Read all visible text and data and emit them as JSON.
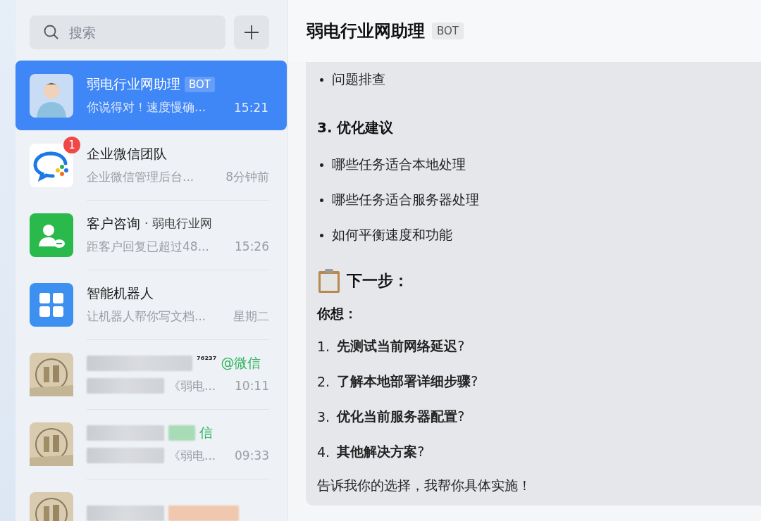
{
  "search": {
    "placeholder": "搜索"
  },
  "chats": [
    {
      "kind": "person",
      "name": "弱电行业网助理",
      "tag": "BOT",
      "preview": "你说得对！速度慢确...",
      "time": "15:21",
      "selected": true
    },
    {
      "kind": "wecom",
      "name": "企业微信团队",
      "badge": "1",
      "preview": "企业微信管理后台...",
      "time": "8分钟前",
      "selected": false
    },
    {
      "kind": "contact",
      "name": "客户咨询",
      "source": "· 弱电行业网",
      "preview": "距客户回复已超过48...",
      "time": "15:26",
      "selected": false
    },
    {
      "kind": "apps",
      "name": "智能机器人",
      "preview": "让机器人帮你写文档...",
      "time": "星期二",
      "selected": false
    },
    {
      "kind": "picture",
      "blurred": true,
      "name": "⁷⁶²³⁷",
      "suffix": "@微信",
      "preview": "《弱电...",
      "time": "10:11",
      "selected": false
    },
    {
      "kind": "picture",
      "blurred": true,
      "suffix": "信",
      "preview": "《弱电...",
      "time": "09:33",
      "selected": false
    },
    {
      "kind": "picture",
      "blurred": true,
      "selected": false
    }
  ],
  "conversation": {
    "title": "弱电行业网助理",
    "tag": "BOT",
    "message": [
      {
        "kind": "bullet",
        "text": "问题排查"
      },
      {
        "kind": "heading",
        "text": "3. 优化建议"
      },
      {
        "kind": "bullet",
        "text": "哪些任务适合本地处理"
      },
      {
        "kind": "bullet",
        "text": "哪些任务适合服务器处理"
      },
      {
        "kind": "bullet",
        "text": "如何平衡速度和功能"
      },
      {
        "kind": "clipboard-heading",
        "text": "下一步："
      },
      {
        "kind": "bold",
        "text": "你想："
      },
      {
        "kind": "numbered",
        "number": "1.",
        "text": "**先测试当前网络延迟**?"
      },
      {
        "kind": "numbered",
        "number": "2.",
        "text": "**了解本地部署详细步骤**?"
      },
      {
        "kind": "numbered",
        "number": "3.",
        "text": "**优化当前服务器配置**?"
      },
      {
        "kind": "numbered",
        "number": "4.",
        "text": "**其他解决方案**?"
      },
      {
        "kind": "paragraph",
        "text": "告诉我你的选择，我帮你具体实施！"
      }
    ]
  }
}
